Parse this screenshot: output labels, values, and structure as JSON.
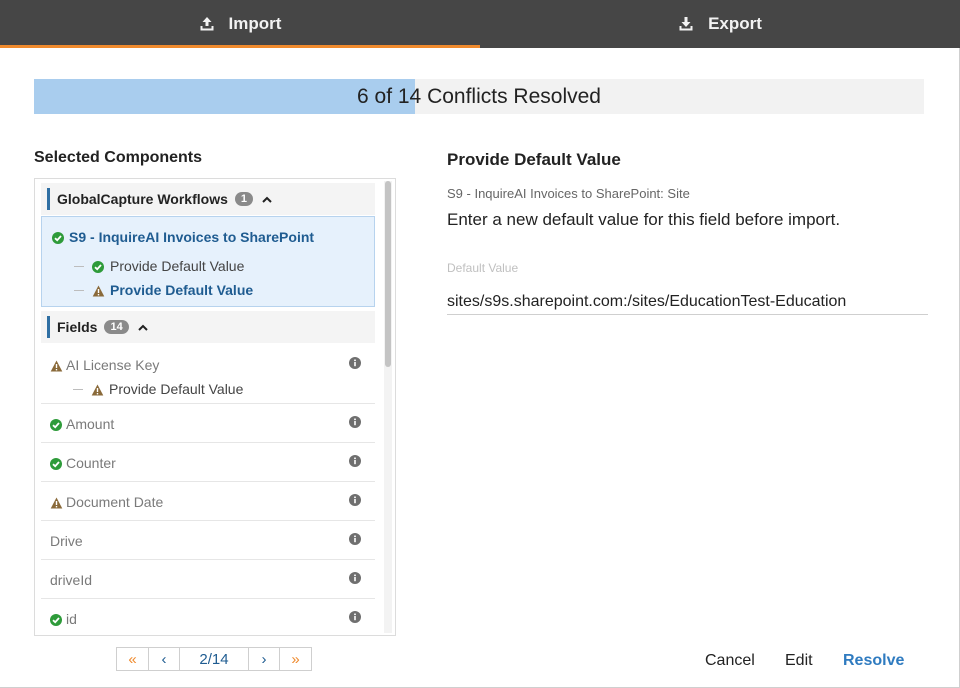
{
  "tabs": {
    "import_label": "Import",
    "export_label": "Export",
    "import_icon": "upload-icon",
    "export_icon": "download-icon",
    "active_accent": "#ef8a2d"
  },
  "progress": {
    "text": "6 of 14 Conflicts Resolved",
    "resolved": 6,
    "total": 14,
    "fill_color": "#a9cdee"
  },
  "left": {
    "title": "Selected Components",
    "workflows": {
      "label": "GlobalCapture Workflows",
      "count": "1",
      "item": {
        "label": "S9 - InquireAI Invoices to SharePoint",
        "status": "resolved",
        "subitems": [
          {
            "label": "Provide Default Value",
            "status": "resolved"
          },
          {
            "label": "Provide Default Value",
            "status": "warning",
            "selected": true
          }
        ]
      }
    },
    "fields": {
      "label": "Fields",
      "count": "14",
      "items": [
        {
          "label": "AI License Key",
          "status": "warning",
          "sub": "Provide Default Value"
        },
        {
          "label": "Amount",
          "status": "resolved"
        },
        {
          "label": "Counter",
          "status": "resolved"
        },
        {
          "label": "Document Date",
          "status": "warning"
        },
        {
          "label": "Drive",
          "status": "none"
        },
        {
          "label": "driveId",
          "status": "none"
        },
        {
          "label": "id",
          "status": "resolved"
        }
      ]
    }
  },
  "pager": {
    "first": "«",
    "prev": "‹",
    "page": "2/14",
    "next": "›",
    "last": "»"
  },
  "right": {
    "title": "Provide Default Value",
    "path": "S9 - InquireAI Invoices to SharePoint: Site",
    "description": "Enter a new default value for this field before import.",
    "field_label": "Default Value",
    "field_value": "sites/s9s.sharepoint.com:/sites/EducationTest-Education"
  },
  "buttons": {
    "cancel": "Cancel",
    "edit": "Edit",
    "resolve": "Resolve"
  },
  "colors": {
    "resolved": "#2e9b3a",
    "warning": "#8a6a3a",
    "link_blue": "#1f5c91",
    "resolve_blue": "#2f7bc0"
  }
}
